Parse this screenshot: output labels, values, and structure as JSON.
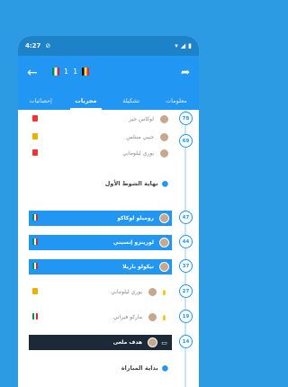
{
  "status": {
    "time": "4:27",
    "notif": "⊘"
  },
  "header": {
    "home_score": "1",
    "away_score": "1"
  },
  "tabs": [
    {
      "label": "معلومات",
      "active": false
    },
    {
      "label": "تشكيلة",
      "active": false
    },
    {
      "label": "مجريات",
      "active": true
    },
    {
      "label": "إحصائيات",
      "active": false
    }
  ],
  "events": [
    {
      "type": "plain",
      "name": "لوكاس جير",
      "sub": "",
      "minute": "78"
    },
    {
      "type": "plain",
      "name": "جيبي مبتلس",
      "sub": "",
      "minute": "69"
    },
    {
      "type": "plain",
      "name": "يوري ليلوماني",
      "sub": "",
      "minute": ""
    },
    {
      "type": "section",
      "name": "نهاية الشوط الأول"
    },
    {
      "type": "ev",
      "name": "روميلو لوكاكو",
      "sub": "",
      "minute": "47"
    },
    {
      "type": "ev",
      "name": "لورينزو إنسيني",
      "sub": "",
      "minute": "44"
    },
    {
      "type": "ev",
      "name": "نيكولو باريلا",
      "sub": "",
      "minute": "37"
    },
    {
      "type": "plain",
      "name": "يوري ليلوماني",
      "sub": "",
      "minute": "27"
    },
    {
      "type": "plain",
      "name": "ماركو فيراتي",
      "sub": "",
      "minute": "19"
    },
    {
      "type": "dark",
      "name": "هدف ملغى",
      "sub": "",
      "minute": "14"
    },
    {
      "type": "section",
      "name": "بداية المباراة"
    }
  ]
}
